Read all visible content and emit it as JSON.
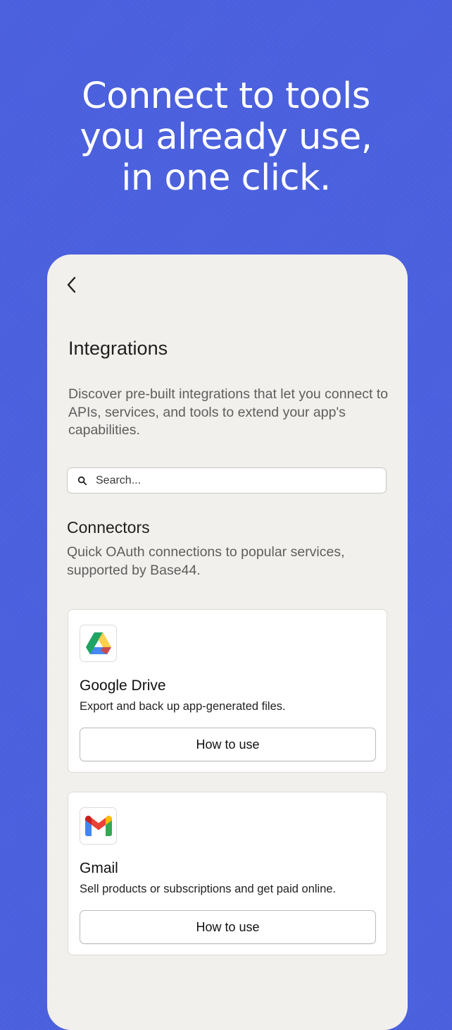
{
  "headline": {
    "line1": "Connect to tools",
    "line2": "you already use,",
    "line3": "in one click."
  },
  "page": {
    "title": "Integrations",
    "description": "Discover pre-built integrations that let you connect to APIs, services, and tools to extend your app's capabilities."
  },
  "search": {
    "placeholder": "Search..."
  },
  "connectors": {
    "title": "Connectors",
    "description": "Quick OAuth connections to popular services, supported by Base44.",
    "items": [
      {
        "name": "Google Drive",
        "description": "Export and back up app-generated files.",
        "button_label": "How to use",
        "icon": "google-drive-icon"
      },
      {
        "name": "Gmail",
        "description": "Sell products or subscriptions and get paid online.",
        "button_label": "How to use",
        "icon": "gmail-icon"
      }
    ]
  },
  "colors": {
    "background": "#4a60e0",
    "panel": "#f2f0ed",
    "card": "#ffffff",
    "headline_text": "#ffffff"
  }
}
